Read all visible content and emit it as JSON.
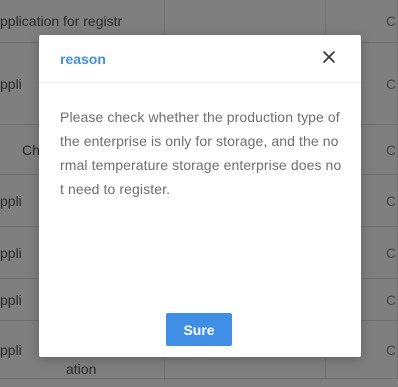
{
  "background_table": {
    "rows": [
      {
        "c1": "pplication for registr",
        "c2": "",
        "c3": "C"
      },
      {
        "c1": "ppli",
        "c2": "",
        "c3": "C"
      },
      {
        "c1": "Ch",
        "c2": "",
        "c3": "C"
      },
      {
        "c1": "ppli",
        "c2": "",
        "c3": "C"
      },
      {
        "c1": "ppli",
        "c2": "",
        "c3": "C"
      },
      {
        "c1": "ppli",
        "c2": "",
        "c3": "C"
      },
      {
        "c1": "ppli",
        "c2": "",
        "c3": "C"
      },
      {
        "c1": "ation",
        "c2": "",
        "c3": ""
      }
    ]
  },
  "modal": {
    "title": "reason",
    "close_icon": "close-icon",
    "body": "Please check whether the production type of the enterprise is only for storage, and the normal temperature storage enterprise does not need to register.",
    "confirm_label": "Sure"
  },
  "colors": {
    "accent": "#3f8fe6",
    "overlay": "rgba(0,0,0,0.5)",
    "body_text": "#6f6f6f"
  }
}
